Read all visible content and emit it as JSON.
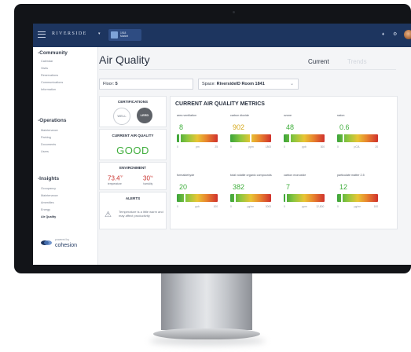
{
  "app": {
    "brand": "RIVERSIDE",
    "site_name_line1": "1918",
    "site_name_line2": "Market"
  },
  "topbar_icons": [
    "bell-icon",
    "settings-icon"
  ],
  "sidebar": {
    "sections": [
      {
        "heading": "Community",
        "items": [
          "Calendar",
          "Visits",
          "Reservations",
          "Communications",
          "Information"
        ]
      },
      {
        "heading": "Operations",
        "items": [
          "Maintenance",
          "Parking",
          "Documents",
          "Users"
        ]
      },
      {
        "heading": "Insights",
        "items": [
          "Occupancy",
          "Maintenance",
          "Amenities",
          "Energy",
          "Air Quality"
        ]
      }
    ],
    "active_item": "Air Quality",
    "powered_by": "powered by",
    "logo_text": "cohesion"
  },
  "page": {
    "title": "Air Quality",
    "tabs": [
      "Current",
      "Trends"
    ],
    "active_tab": "Current"
  },
  "filters": {
    "floor_label": "Floor:",
    "floor_value": "5",
    "space_label": "Space:",
    "space_value": "RiversideID Room 1841"
  },
  "certifications": {
    "title": "CERTIFICATIONS",
    "badges": [
      "WELL",
      "LEED"
    ]
  },
  "air_quality": {
    "title": "CURRENT AIR QUALITY",
    "status": "GOOD",
    "status_color": "#3fae3c"
  },
  "environment": {
    "title": "ENVIRONMENT",
    "temperature_value": "73.4",
    "temperature_unit": "°F",
    "temperature_label": "temperature",
    "humidity_value": "30",
    "humidity_unit": "%",
    "humidity_label": "humidity"
  },
  "alerts": {
    "title": "ALERTS",
    "message": "Temperature is a little warm and may affect productivity"
  },
  "metrics_panel": {
    "title": "CURRENT AIR QUALITY METRICS",
    "metrics": [
      {
        "label": "area ventilation",
        "value": "8",
        "color": "#3fae3c",
        "level": 0.08,
        "min": "0",
        "unit": "pm",
        "max": "25"
      },
      {
        "label": "carbon dioxide",
        "value": "902",
        "color": "#d6a91c",
        "level": 0.5,
        "min": "0",
        "unit": "ppm",
        "max": "1800"
      },
      {
        "label": "ozone",
        "value": "48",
        "color": "#3fae3c",
        "level": 0.16,
        "min": "0",
        "unit": "ppb",
        "max": "300"
      },
      {
        "label": "radon",
        "value": "0.6",
        "color": "#3fae3c",
        "level": 0.15,
        "min": "0",
        "unit": "pCi/L",
        "max": "20"
      },
      {
        "label": "formaldehyde",
        "value": "20",
        "color": "#3fae3c",
        "level": 0.2,
        "min": "0",
        "unit": "ppb",
        "max": "100"
      },
      {
        "label": "total volatile organic compounds",
        "value": "382",
        "color": "#3fae3c",
        "level": 0.12,
        "min": "0",
        "unit": "µg/m³",
        "max": "3000"
      },
      {
        "label": "carbon monoxide",
        "value": "7",
        "color": "#3fae3c",
        "level": 0.05,
        "min": "0",
        "unit": "ppm",
        "max": "12,800"
      },
      {
        "label": "particulate matter 2.5",
        "value": "12",
        "color": "#3fae3c",
        "level": 0.12,
        "min": "0",
        "unit": "µg/m³",
        "max": "100"
      }
    ]
  }
}
